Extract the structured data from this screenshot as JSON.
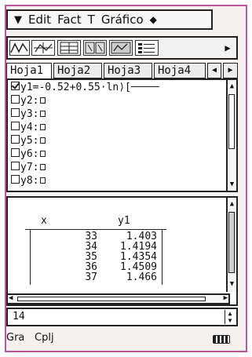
{
  "menubar": {
    "menu_icon": "chevron-down-icon",
    "items": [
      "Edit",
      "Fact",
      "T",
      "Gráfico"
    ],
    "diamond_icon": "diamond-icon"
  },
  "toolbar": {
    "buttons": [
      "graph-line-icon",
      "graph-style-icon",
      "table-icon",
      "graph-table-icon",
      "split-view-icon",
      "list-icon",
      "arrow-right-icon"
    ]
  },
  "tabs": [
    "Hoja1",
    "Hoja2",
    "Hoja3",
    "Hoja4"
  ],
  "active_tab": 0,
  "equations": [
    {
      "label": "y1=",
      "expr": "-0.52+0.55·ln⟩[",
      "checked": true
    },
    {
      "label": "y2:",
      "expr": "",
      "checked": false
    },
    {
      "label": "y3:",
      "expr": "",
      "checked": false
    },
    {
      "label": "y4:",
      "expr": "",
      "checked": false
    },
    {
      "label": "y5:",
      "expr": "",
      "checked": false
    },
    {
      "label": "y6:",
      "expr": "",
      "checked": false
    },
    {
      "label": "y7:",
      "expr": "",
      "checked": false
    },
    {
      "label": "y8:",
      "expr": "",
      "checked": false
    }
  ],
  "table": {
    "headers": [
      "x",
      "y1"
    ],
    "x_values": [
      "33",
      "34",
      "35",
      "36",
      "37"
    ],
    "y1_values": [
      "1.403",
      "1.4194",
      "1.4354",
      "1.4509",
      "1.466"
    ]
  },
  "input_line": {
    "value": "14"
  },
  "statusbar": {
    "left": "Gra",
    "mode": "Cplj",
    "battery_icon": "battery-icon"
  },
  "colors": {
    "frame": "#c2559a"
  }
}
